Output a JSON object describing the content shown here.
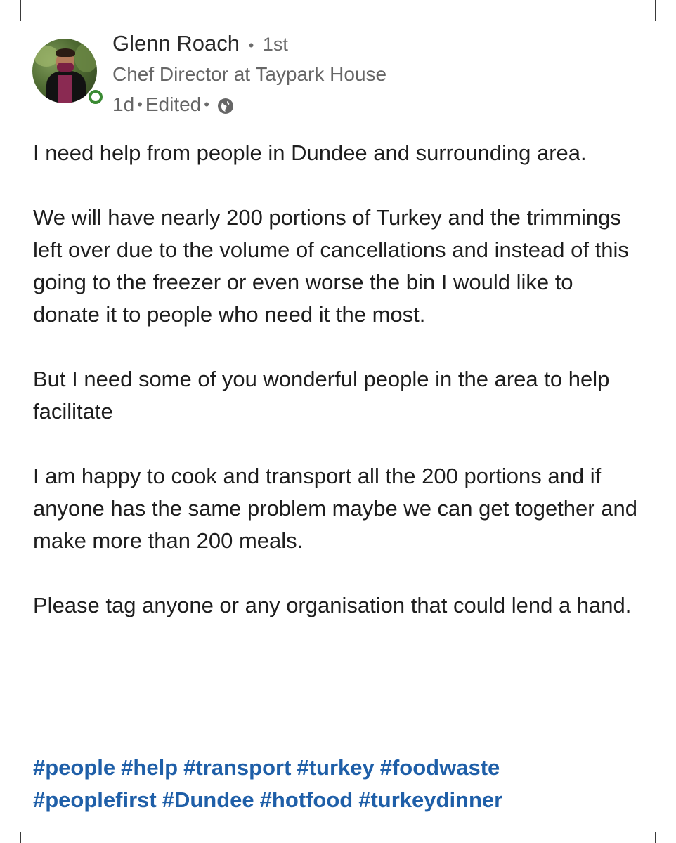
{
  "author": {
    "name": "Glenn Roach",
    "degree": "1st",
    "headline": "Chef Director at Taypark House",
    "time": "1d",
    "edited": "Edited",
    "visibility_icon": "globe-icon",
    "status_color": "#3a8a33"
  },
  "post": {
    "paragraphs": [
      "I need help from people in Dundee and surrounding area.",
      "We will have nearly 200 portions of Turkey and the trimmings left over due to the volume of cancellations and instead of this going to the freezer or even worse the bin I would like to donate it to people who need it the most.",
      "But I need some of you wonderful people in the area to help facilitate",
      "I am happy to cook and transport all the 200 portions and if anyone has the same problem maybe we can get together and make more than 200 meals.",
      "Please tag anyone or any organisation that could lend a hand."
    ],
    "hashtag_lines": [
      [
        "#people",
        "#help",
        "#transport",
        "#turkey",
        "#foodwaste"
      ],
      [
        "#peoplefirst",
        "#Dundee",
        "#hotfood",
        "#turkeydinner"
      ]
    ]
  },
  "colors": {
    "hashtag": "#1f5fa8",
    "meta_text": "#666666"
  }
}
